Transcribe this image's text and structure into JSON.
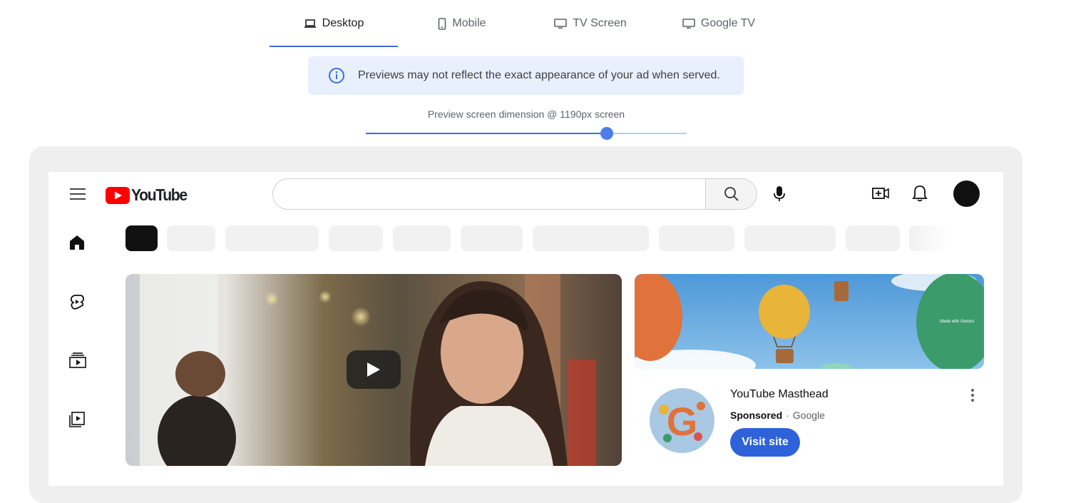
{
  "tabs": [
    {
      "label": "Desktop",
      "icon": "laptop-icon",
      "active": true
    },
    {
      "label": "Mobile",
      "icon": "phone-icon",
      "active": false
    },
    {
      "label": "TV Screen",
      "icon": "tv-icon",
      "active": false
    },
    {
      "label": "Google TV",
      "icon": "tv-icon",
      "active": false
    }
  ],
  "notice": {
    "icon": "info-icon",
    "text": "Previews may not reflect the exact appearance of your ad when served."
  },
  "slider": {
    "label": "Preview screen dimension @ 1190px screen",
    "value_fraction": 0.75
  },
  "youtube": {
    "logo_text": "YouTube",
    "search_placeholder": "",
    "chip_count": 11,
    "sidebar_icons": [
      "home-icon",
      "shorts-icon",
      "subscriptions-icon",
      "library-icon"
    ],
    "banner_watermark": "Made with Gemini",
    "ad": {
      "title": "YouTube Masthead",
      "sponsored": "Sponsored",
      "separator": "·",
      "advertiser": "Google",
      "cta": "Visit site"
    }
  },
  "colors": {
    "accent": "#3b6fd4",
    "notice_bg": "#e8f0fe",
    "yt_red": "#ff0000",
    "cta_bg": "#2e62d8"
  }
}
